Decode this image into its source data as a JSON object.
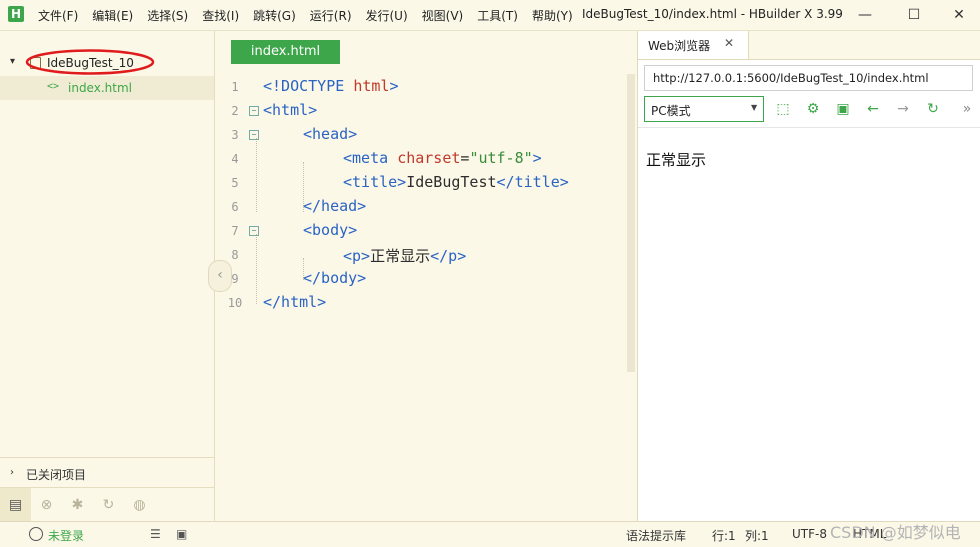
{
  "app": {
    "logo_letter": "H",
    "window_title": "IdeBugTest_10/index.html - HBuilder X 3.99",
    "menu": [
      "文件(F)",
      "编辑(E)",
      "选择(S)",
      "查找(I)",
      "跳转(G)",
      "运行(R)",
      "发行(U)",
      "视图(V)",
      "工具(T)",
      "帮助(Y)"
    ],
    "window_buttons": {
      "minimize": "—",
      "maximize": "☐",
      "close": "✕"
    }
  },
  "sidebar": {
    "project_name": "IdeBugTest_10",
    "file_icon": "<>",
    "file_name": "index.html",
    "closed_projects": "已关闭项目",
    "annotation_color": "#e01b1b"
  },
  "editor": {
    "tab_label": "index.html",
    "lines": [
      {
        "n": "1",
        "segments": [
          [
            "tg",
            "<!DOCTYPE "
          ],
          [
            "at",
            "html"
          ],
          [
            "tg",
            ">"
          ]
        ]
      },
      {
        "n": "2",
        "segments": [
          [
            "tg",
            "<html>"
          ]
        ]
      },
      {
        "n": "3",
        "segments": [
          [
            "tg",
            "<head>"
          ]
        ]
      },
      {
        "n": "4",
        "segments": [
          [
            "tg",
            "<meta "
          ],
          [
            "at",
            "charset"
          ],
          [
            "tx",
            "="
          ],
          [
            "st",
            "\"utf-8\""
          ],
          [
            "tg",
            ">"
          ]
        ]
      },
      {
        "n": "5",
        "segments": [
          [
            "tg",
            "<title>"
          ],
          [
            "tx",
            "IdeBugTest"
          ],
          [
            "tg",
            "</title>"
          ]
        ]
      },
      {
        "n": "6",
        "segments": [
          [
            "tg",
            "</head>"
          ]
        ]
      },
      {
        "n": "7",
        "segments": [
          [
            "tg",
            "<body>"
          ]
        ]
      },
      {
        "n": "8",
        "segments": [
          [
            "tg",
            "<p>"
          ],
          [
            "tx",
            "正常显示"
          ],
          [
            "tg",
            "</p>"
          ]
        ]
      },
      {
        "n": "9",
        "segments": [
          [
            "tg",
            "</body>"
          ]
        ]
      },
      {
        "n": "10",
        "segments": [
          [
            "tg",
            "</html>"
          ]
        ]
      }
    ]
  },
  "browser": {
    "tab_label": "Web浏览器",
    "url": "http://127.0.0.1:5600/IdeBugTest_10/index.html",
    "mode": "PC模式",
    "page_text": "正常显示"
  },
  "status": {
    "login": "未登录",
    "syntax_hint": "语法提示库",
    "line": "行:1",
    "col": "列:1",
    "encoding": "UTF-8",
    "language": "HTML",
    "watermark": "CSDN @如梦似电"
  },
  "colors": {
    "accent": "#3ea64a",
    "background": "#fbf8e8",
    "tag": "#2a63c4",
    "attr": "#c0392b",
    "string": "#3a8b3a"
  }
}
